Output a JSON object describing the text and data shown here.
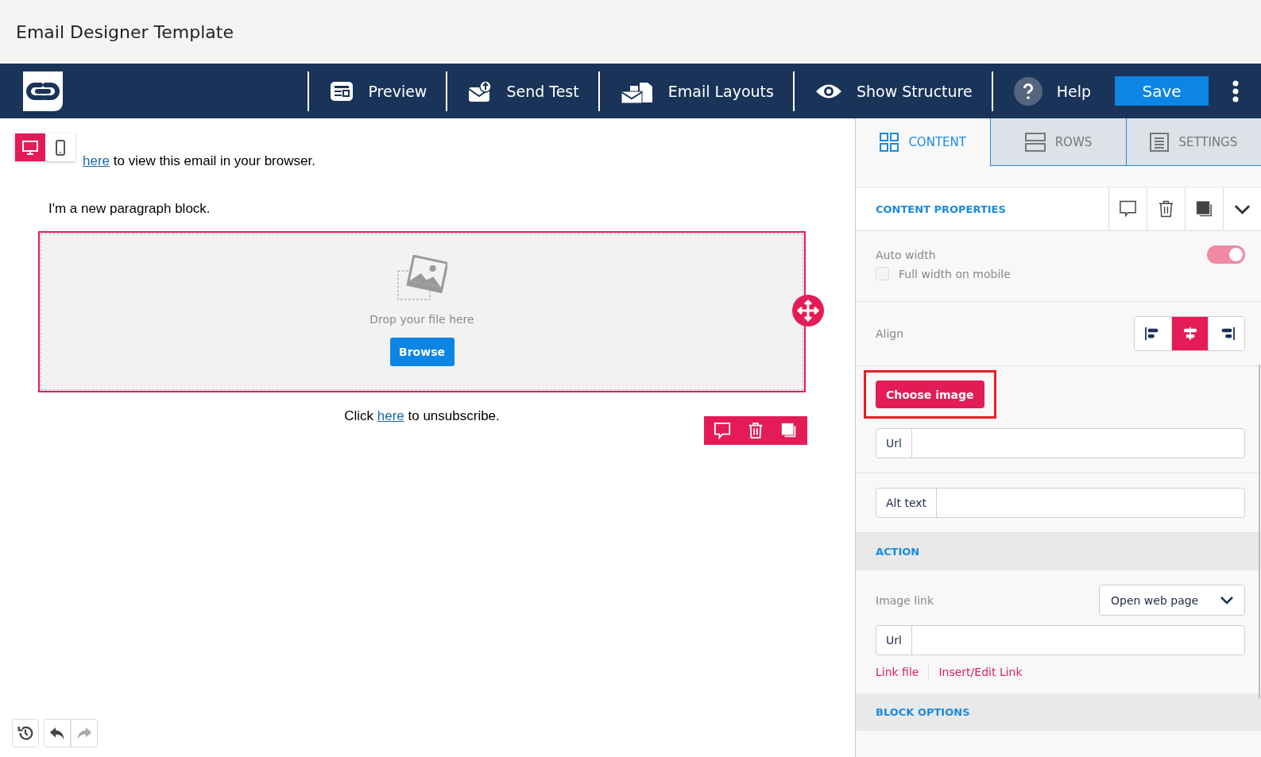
{
  "page_title": "Email Designer Template",
  "toolbar": {
    "items": [
      {
        "kind": "preview",
        "label": "Preview"
      },
      {
        "kind": "send",
        "label": "Send Test"
      },
      {
        "kind": "layouts",
        "label": "Email Layouts"
      },
      {
        "kind": "structure",
        "label": "Show Structure"
      },
      {
        "kind": "help",
        "label": "Help"
      }
    ],
    "save": "Save"
  },
  "device_toggle": [
    {
      "kind": "desktop",
      "selected": true
    },
    {
      "kind": "mobile",
      "selected": false
    }
  ],
  "canvas": {
    "header_link": "here",
    "header_text": "to view this email in your browser.",
    "paragraph": "I'm a new paragraph block.",
    "image_block": {
      "drop_text": "Drop your file here",
      "browse": "Browse"
    },
    "footer": {
      "before": "Click",
      "link": "here",
      "after": "to unsubscribe."
    }
  },
  "history": [
    {
      "kind": "history",
      "disabled": false
    },
    {
      "kind": "undo",
      "disabled": false
    },
    {
      "kind": "redo",
      "disabled": true
    }
  ],
  "tabs": [
    {
      "kind": "content",
      "label": "CONTENT",
      "selected": true
    },
    {
      "kind": "rows",
      "label": "ROWS",
      "selected": false
    },
    {
      "kind": "settings",
      "label": "SETTINGS",
      "selected": false
    }
  ],
  "properties": {
    "title": "CONTENT PROPERTIES",
    "auto_width": {
      "label": "Auto width",
      "on": true
    },
    "full_width": {
      "label": "Full width on mobile",
      "checked": false
    },
    "align": {
      "label": "Align",
      "options": [
        {
          "kind": "left",
          "selected": false
        },
        {
          "kind": "center",
          "selected": true
        },
        {
          "kind": "right",
          "selected": false
        }
      ]
    },
    "choose_image": "Choose image",
    "url_label": "Url",
    "alt_label": "Alt text"
  },
  "action": {
    "title": "ACTION",
    "image_link_label": "Image link",
    "image_link_value": "Open web page",
    "url_label": "Url",
    "links": [
      "Link file",
      "Insert/Edit Link"
    ]
  },
  "block_options": {
    "title": "BLOCK OPTIONS"
  }
}
